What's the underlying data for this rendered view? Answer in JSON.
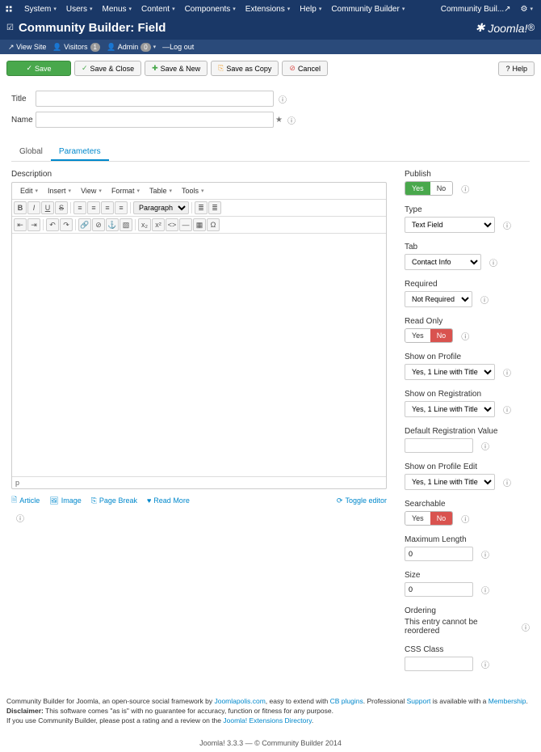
{
  "topnav": {
    "items": [
      "System",
      "Users",
      "Menus",
      "Content",
      "Components",
      "Extensions",
      "Help",
      "Community Builder"
    ],
    "right": "Community Buil...",
    "gear": "gear"
  },
  "header": {
    "title": "Community Builder: Field",
    "logo": "Joomla!"
  },
  "submenu": {
    "viewsite": "View Site",
    "visitors": "Visitors",
    "visitors_badge": "1",
    "admin": "Admin",
    "admin_badge": "0",
    "logout": "Log out"
  },
  "toolbar": {
    "save": "Save",
    "saveclose": "Save & Close",
    "savenew": "Save & New",
    "savecopy": "Save as Copy",
    "cancel": "Cancel",
    "help": "Help"
  },
  "form": {
    "title_lbl": "Title",
    "name_lbl": "Name"
  },
  "tabs": {
    "global": "Global",
    "parameters": "Parameters"
  },
  "editor": {
    "desc_label": "Description",
    "menu": [
      "Edit",
      "Insert",
      "View",
      "Format",
      "Table",
      "Tools"
    ],
    "paragraph": "Paragraph",
    "status": "p",
    "actions": {
      "article": "Article",
      "image": "Image",
      "pagebreak": "Page Break",
      "readmore": "Read More",
      "toggle": "Toggle editor"
    }
  },
  "side": {
    "publish": {
      "lbl": "Publish",
      "yes": "Yes",
      "no": "No"
    },
    "type": {
      "lbl": "Type",
      "val": "Text Field"
    },
    "tab": {
      "lbl": "Tab",
      "val": "Contact Info"
    },
    "required": {
      "lbl": "Required",
      "val": "Not Required"
    },
    "readonly": {
      "lbl": "Read Only",
      "yes": "Yes",
      "no": "No"
    },
    "showprofile": {
      "lbl": "Show on Profile",
      "val": "Yes, 1 Line with Title"
    },
    "showreg": {
      "lbl": "Show on Registration",
      "val": "Yes, 1 Line with Title"
    },
    "defregval": {
      "lbl": "Default Registration Value"
    },
    "showprofedit": {
      "lbl": "Show on Profile Edit",
      "val": "Yes, 1 Line with Title"
    },
    "searchable": {
      "lbl": "Searchable",
      "yes": "Yes",
      "no": "No"
    },
    "maxlen": {
      "lbl": "Maximum Length",
      "val": "0"
    },
    "size": {
      "lbl": "Size",
      "val": "0"
    },
    "ordering": {
      "lbl": "Ordering",
      "txt": "This entry cannot be reordered"
    },
    "cssclass": {
      "lbl": "CSS Class"
    }
  },
  "footer": {
    "l1a": "Community Builder for Joomla, an open-source social framework by ",
    "l1b": "Joomlapolis.com",
    "l1c": ", easy to extend with ",
    "l1d": "CB plugins",
    "l1e": ". Professional ",
    "l1f": "Support",
    "l1g": " is available with a ",
    "l1h": "Membership",
    "l2a": "Disclaimer:",
    "l2b": " This software comes \"as is\" with no guarantee for accuracy, function or fitness for any purpose.",
    "l3a": "If you use Community Builder, please post a rating and a review on the ",
    "l3b": "Joomla! Extensions Directory",
    "center": "Joomla! 3.3.3  —  © Community Builder 2014"
  }
}
